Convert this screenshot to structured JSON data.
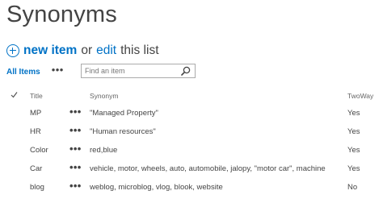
{
  "page": {
    "title": "Synonyms"
  },
  "commands": {
    "new_item": "new item",
    "or_text": "or",
    "edit": "edit",
    "this_list": "this list"
  },
  "views": {
    "current": "All Items",
    "more": "•••"
  },
  "search": {
    "placeholder": "Find an item",
    "value": ""
  },
  "table": {
    "columns": [
      "Title",
      "Synonym",
      "TwoWay"
    ],
    "row_menu": "•••",
    "rows": [
      {
        "title": "MP",
        "synonym": "\"Managed Property\"",
        "twoway": "Yes"
      },
      {
        "title": "HR",
        "synonym": "\"Human resources\"",
        "twoway": "Yes"
      },
      {
        "title": "Color",
        "synonym": "red,blue",
        "twoway": "Yes"
      },
      {
        "title": "Car",
        "synonym": "vehicle, motor, wheels, auto, automobile, jalopy, \"motor car\", machine",
        "twoway": "Yes"
      },
      {
        "title": "blog",
        "synonym": "weblog, microblog, vlog, blook, website",
        "twoway": "No"
      }
    ]
  },
  "icons": {
    "add": "plus-circle-icon",
    "search": "search-icon",
    "select_all": "checkmark-icon"
  },
  "colors": {
    "accent": "#0072c6",
    "text": "#444444",
    "muted": "#777777"
  }
}
